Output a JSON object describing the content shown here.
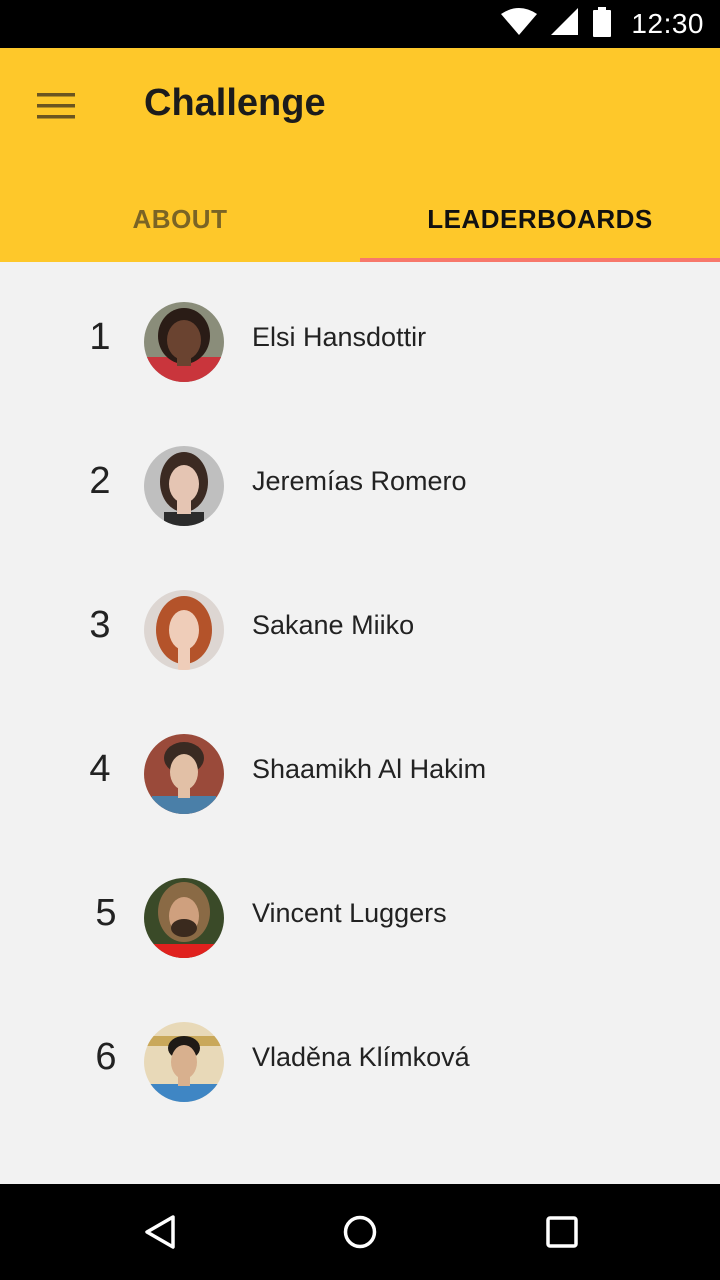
{
  "status_bar": {
    "time": "12:30",
    "icons": [
      "wifi-icon",
      "signal-icon",
      "battery-icon"
    ]
  },
  "app_bar": {
    "title": "Challenge",
    "menu_icon": "hamburger-menu-icon",
    "background": "#fec82a"
  },
  "tabs": [
    {
      "label": "ABOUT",
      "selected": false
    },
    {
      "label": "LEADERBOARDS",
      "selected": true
    }
  ],
  "accent_color": "#f7786b",
  "leaderboard": [
    {
      "rank": "1",
      "name": "Elsi Hansdottir"
    },
    {
      "rank": "2",
      "name": "Jeremías Romero"
    },
    {
      "rank": "3",
      "name": "Sakane Miiko"
    },
    {
      "rank": "4",
      "name": "Shaamikh Al Hakim"
    },
    {
      "rank": "5",
      "name": "Vincent Luggers"
    },
    {
      "rank": "6",
      "name": "Vladěna Klímková"
    }
  ],
  "nav_bar": {
    "icons": [
      "back-icon",
      "home-icon",
      "recents-icon"
    ]
  }
}
